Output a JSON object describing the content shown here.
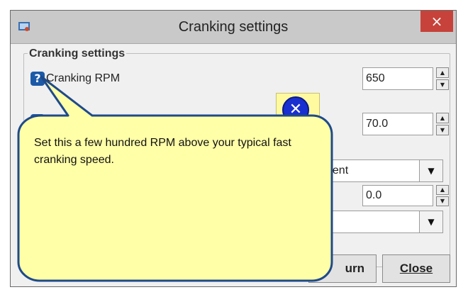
{
  "window": {
    "title": "Cranking settings",
    "close_glyph": "×"
  },
  "group": {
    "title": "Cranking settings"
  },
  "fields": {
    "cranking_rpm": {
      "label": "Cranking RPM",
      "value": "650"
    },
    "second_value": "70.0",
    "dropdown1_value": "event",
    "third_value": "0.0",
    "dropdown2_value": ""
  },
  "tooltip": {
    "text": "Set this a few hundred RPM above your typical fast cranking speed."
  },
  "buttons": {
    "return_partial": "urn",
    "close_label": "Close"
  },
  "icons": {
    "help": "?",
    "dismiss": "✕"
  },
  "colors": {
    "tooltip_fill": "#ffffa8",
    "tooltip_border": "#1f4a8a",
    "close_red": "#c7423a",
    "help_blue": "#1c5aa8"
  }
}
